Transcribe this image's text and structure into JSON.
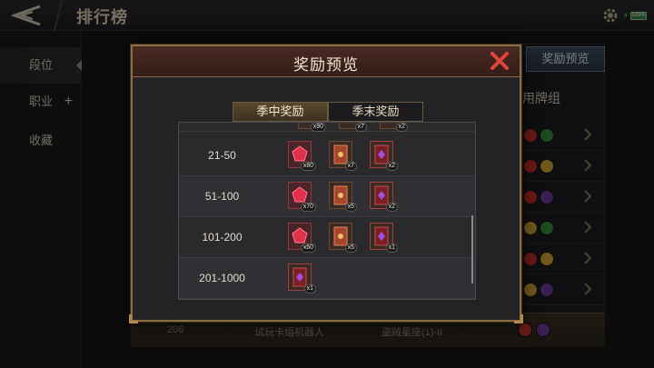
{
  "header": {
    "title": "排行榜",
    "battery": "100%"
  },
  "sidebar": {
    "items": [
      {
        "label": "段位"
      },
      {
        "label": "职业"
      },
      {
        "label": "收藏"
      }
    ]
  },
  "main": {
    "preview_button": "奖励预览",
    "deck_header": "用牌组",
    "bottom_row": {
      "rank": "206",
      "player": "试玩卡组机器人",
      "deck": "盗贼星座(1)-II"
    }
  },
  "modal": {
    "title": "奖励预览",
    "tabs": [
      {
        "label": "季中奖励",
        "active": true
      },
      {
        "label": "季末奖励",
        "active": false
      }
    ],
    "partial_row": {
      "qty": [
        "x90",
        "x7",
        "x2"
      ]
    },
    "rows": [
      {
        "rank": "21-50",
        "items": [
          {
            "icon": "red-gem-icon",
            "qty": "x80"
          },
          {
            "icon": "card-pack-icon",
            "qty": "x7"
          },
          {
            "icon": "purple-card-icon",
            "qty": "x2"
          }
        ]
      },
      {
        "rank": "51-100",
        "items": [
          {
            "icon": "red-gem-icon",
            "qty": "x70"
          },
          {
            "icon": "card-pack-icon",
            "qty": "x5"
          },
          {
            "icon": "purple-card-icon",
            "qty": "x2"
          }
        ]
      },
      {
        "rank": "101-200",
        "items": [
          {
            "icon": "red-gem-icon",
            "qty": "x60"
          },
          {
            "icon": "card-pack-icon",
            "qty": "x5"
          },
          {
            "icon": "purple-card-icon",
            "qty": "x1"
          }
        ]
      },
      {
        "rank": "201-1000",
        "items": [
          {
            "icon": "purple-card-icon",
            "qty": "x1"
          }
        ]
      }
    ]
  },
  "colors": {
    "accent_gold": "#8a6e42",
    "close_red": "#e0443a",
    "header_bg": "#4a2a22"
  }
}
